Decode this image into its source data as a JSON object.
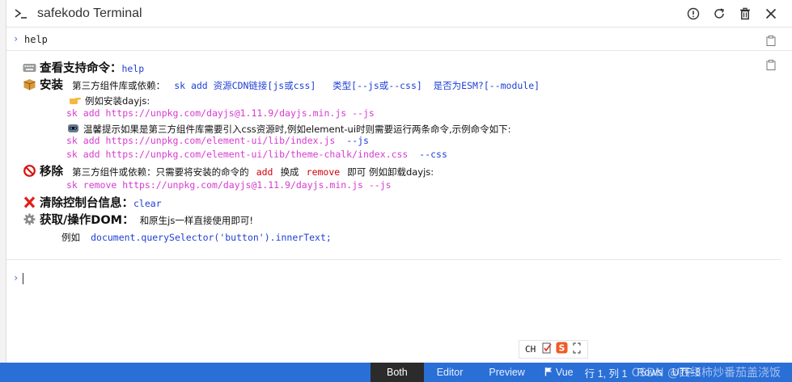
{
  "window": {
    "title": "safekodo Terminal"
  },
  "history": {
    "prompt": "›",
    "command": "help"
  },
  "help": {
    "l1": {
      "title": "查看支持命令：",
      "cmd": "help"
    },
    "l2": {
      "title": "安装",
      "desc": "第三方组件库或依赖：",
      "syntax": "sk add 资源CDN链接[js或css]   类型[--js或--css]  是否为ESM?[--module]"
    },
    "l3": {
      "text": "例如安装dayjs:"
    },
    "l4": {
      "cmd": "sk add https://unpkg.com/dayjs@1.11.9/dayjs.min.js --js"
    },
    "l5": {
      "text": "温馨提示如果是第三方组件库需要引入css资源时,例如element-ui时则需要运行两条命令,示例命令如下:"
    },
    "l6": {
      "cmd": "sk add https://unpkg.com/element-ui/lib/index.js",
      "flag": "--js"
    },
    "l7": {
      "cmd": "sk add https://unpkg.com/element-ui/lib/theme-chalk/index.css",
      "flag": "--css"
    },
    "l8": {
      "title": "移除",
      "desc1": "第三方组件或依赖：只需要将安装的命令的",
      "add": "add",
      "desc2": "换成",
      "remove": "remove",
      "desc3": "即可 例如卸载dayjs:"
    },
    "l9": {
      "cmd": "sk remove https://unpkg.com/dayjs@1.11.9/dayjs.min.js --js"
    },
    "l10": {
      "title": "清除控制台信息：",
      "cmd": "clear"
    },
    "l11": {
      "title": "获取/操作DOM：",
      "desc": "和原生js一样直接使用即可!"
    },
    "l12": {
      "label": "例如",
      "code": "document.querySelector('button').innerText;"
    }
  },
  "input": {
    "prompt": "›",
    "value": ""
  },
  "ime": {
    "lang": "CH"
  },
  "statusbar": {
    "tabs": [
      "Both",
      "Editor",
      "Preview"
    ],
    "active_tab": "Both",
    "framework": "Vue",
    "position": "行 1, 列 1",
    "rows": "Rows",
    "encoding": "UTF-8",
    "watermark": "CSDN @西红柿炒番茄盖浇饭"
  },
  "colors": {
    "accent": "#2a6fd6",
    "active_tab": "#2b2b2b",
    "keyword_blue": "#1e3fd4",
    "command_pink": "#d73ad0",
    "remove_red": "#d2000a"
  },
  "icons": {
    "title": "terminal-icon",
    "actions": [
      "info-icon",
      "refresh-icon",
      "trash-icon",
      "close-icon"
    ],
    "copy": "clipboard-icon",
    "emojis": [
      "keyboard-icon",
      "package-icon",
      "pointing-hand-icon",
      "robot-icon",
      "prohibited-icon",
      "cross-mark-icon",
      "gear-icon"
    ]
  }
}
